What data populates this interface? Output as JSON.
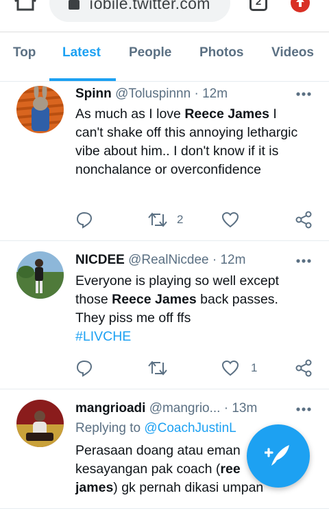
{
  "browser": {
    "url": "mobile.twitter.com",
    "url_visible": "ıobile.twitter.com",
    "tab_count": "2"
  },
  "search_tabs": [
    {
      "label": "Top"
    },
    {
      "label": "Latest",
      "active": true
    },
    {
      "label": "People"
    },
    {
      "label": "Photos"
    },
    {
      "label": "Videos"
    }
  ],
  "tweets": [
    {
      "name": "Spinn",
      "handle": "@Toluspinnn",
      "time": "12m",
      "body_parts": [
        "As much as I love ",
        "Reece James",
        " I can't shake off this annoying lethargic vibe about him.. I don't know if it is nonchalance or overconfidence"
      ],
      "retweets": "2",
      "likes": ""
    },
    {
      "name": "NICDEE",
      "handle": "@RealNicdee",
      "time": "12m",
      "body_parts": [
        "Everyone is playing so well except those ",
        "Reece James",
        " back passes. They piss me off ffs"
      ],
      "hashtag": "#LIVCHE",
      "retweets": "",
      "likes": "1"
    },
    {
      "name": "mangrioadi",
      "handle": "@mangrio...",
      "time": "13m",
      "replying_label": "Replying to ",
      "replying_to": "@CoachJustinL",
      "body_parts": [
        "Perasaan doang atau eman",
        "kesayangan pak coach (",
        "ree",
        "james",
        ") gk pernah dikasi umpan"
      ]
    }
  ],
  "colors": {
    "accent": "#1da1f2",
    "secondary_text": "#5b7083",
    "divider": "#e6ecf0"
  },
  "icons": {
    "fab": "compose-tweet-icon",
    "reply": "reply-icon",
    "retweet": "retweet-icon",
    "like": "heart-icon",
    "share": "share-icon"
  }
}
